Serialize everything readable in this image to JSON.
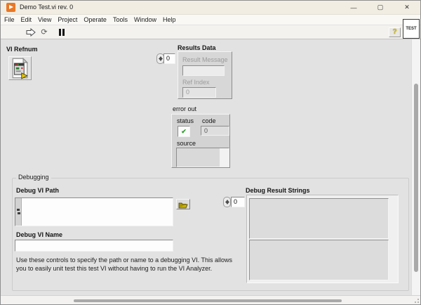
{
  "titlebar": {
    "title": "Demo Test.vi rev. 0"
  },
  "window_icons": {
    "minimize": "—",
    "maximize": "▢",
    "close": "✕"
  },
  "menu": {
    "items": [
      "File",
      "Edit",
      "View",
      "Project",
      "Operate",
      "Tools",
      "Window",
      "Help"
    ]
  },
  "toolbar": {
    "run_continuous_icon": "⟳",
    "help_icon": "?",
    "vi_icon_text": "TEST"
  },
  "panel": {
    "vi_refnum": {
      "label": "VI Refnum"
    },
    "results_data": {
      "label": "Results Data",
      "index": "0",
      "result_message_label": "Result Message",
      "result_message_value": "",
      "ref_index_label": "Ref Index",
      "ref_index_value": "0"
    },
    "error_out": {
      "label": "error out",
      "status_label": "status",
      "status_ok_icon": "✔",
      "code_label": "code",
      "code_value": "0",
      "source_label": "source",
      "source_value": ""
    }
  },
  "debugging": {
    "label": "Debugging",
    "path_label": "Debug VI Path",
    "path_value": "",
    "name_label": "Debug VI Name",
    "name_value": "",
    "help_text": "Use these controls to specify the path or name to a debugging VI. This allows you to easily unit test this test VI without having to run the VI Analyzer.",
    "result_strings": {
      "label": "Debug Result Strings",
      "index": "0",
      "values": [
        "",
        ""
      ]
    }
  },
  "colors": {
    "labview_orange": "#e97826",
    "panel_grey": "#e2e2e2",
    "cluster_grey": "#d7d7d7",
    "status_ok_green": "#2e9e2e",
    "folder_yellow": "#c9b200",
    "help_yellow": "#d6c300",
    "titlebar_cream": "#f1ede3"
  }
}
